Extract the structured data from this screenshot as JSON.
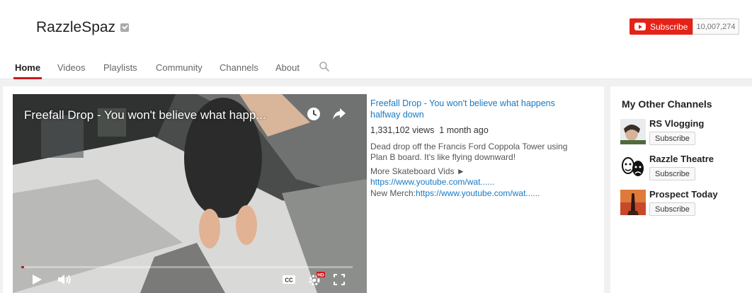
{
  "channel": {
    "name": "RazzleSpaz",
    "subscribe_label": "Subscribe",
    "subscriber_count": "10,007,274"
  },
  "tabs": [
    {
      "label": "Home"
    },
    {
      "label": "Videos"
    },
    {
      "label": "Playlists"
    },
    {
      "label": "Community"
    },
    {
      "label": "Channels"
    },
    {
      "label": "About"
    }
  ],
  "player": {
    "title": "Freefall Drop - You won't believe what happ...",
    "progress_fraction": 0.008,
    "quality_badge": "HD"
  },
  "featured": {
    "title": "Freefall Drop - You won't believe what happens halfway down",
    "views": "1,331,102 views",
    "age": "1 month ago",
    "description": "Dead drop off the Francis Ford Coppola Tower using Plan B board.  It's like flying downward!",
    "more_label": "More Skateboard Vids ►",
    "more_link": "https://www.youtube.com/wat......",
    "merch_label": "New Merch:",
    "merch_link": "https://www.youtube.com/wat......"
  },
  "other_channels": {
    "title": "My Other Channels",
    "items": [
      {
        "name": "RS Vlogging",
        "subscribe_label": "Subscribe"
      },
      {
        "name": "Razzle Theatre",
        "subscribe_label": "Subscribe"
      },
      {
        "name": "Prospect Today",
        "subscribe_label": "Subscribe"
      }
    ]
  },
  "colors": {
    "accent_red": "#e62117",
    "link_blue": "#167ac6",
    "tab_underline": "#cc181e"
  }
}
